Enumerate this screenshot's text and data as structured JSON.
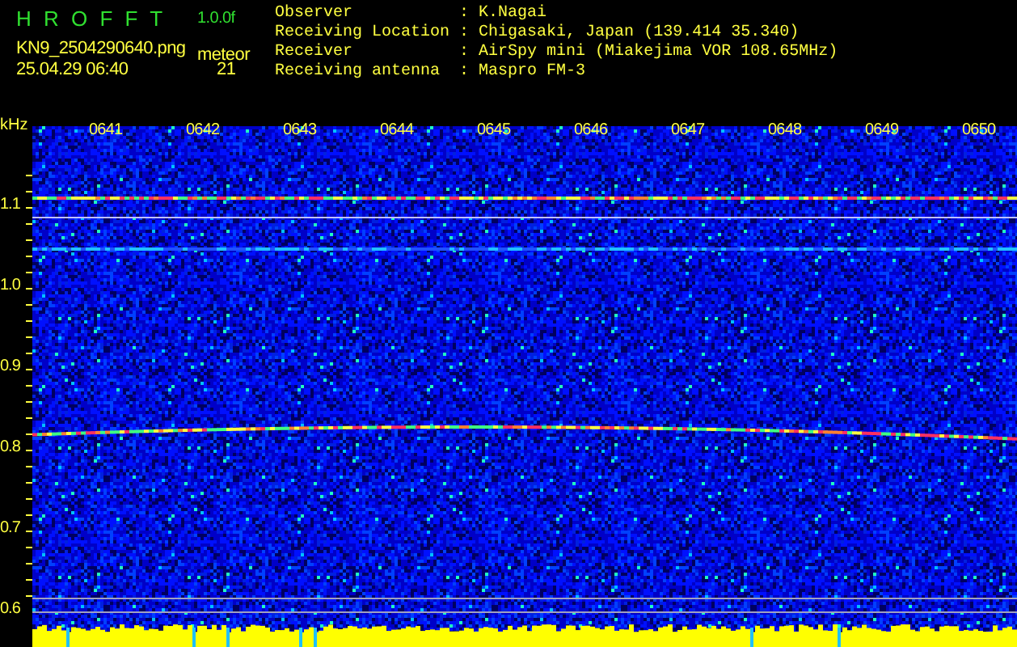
{
  "header": {
    "title": "H R O F F T",
    "version": "1.0.0f",
    "filename": "KN9_2504290640.png",
    "count_label": "meteor",
    "timestamp": "25.04.29 06:40",
    "count": "21"
  },
  "info": [
    {
      "label": "Observer",
      "separator": ":",
      "value": "K.Nagai"
    },
    {
      "label": "Receiving Location",
      "separator": ":",
      "value": "Chigasaki, Japan (139.414 35.340)"
    },
    {
      "label": "Receiver",
      "separator": ":",
      "value": "AirSpy mini (Miakejima VOR 108.65MHz)"
    },
    {
      "label": "Receiving antenna",
      "separator": ":",
      "value": "Maspro FM-3"
    }
  ],
  "plot": {
    "unit": "kHz",
    "y_labels": [
      "1.1",
      "1.0",
      "0.9",
      "0.8",
      "0.7",
      "0.6"
    ],
    "time_labels": [
      "0641",
      "0642",
      "0643",
      "0644",
      "0645",
      "0646",
      "0647",
      "0648",
      "0649",
      "0650"
    ]
  }
}
